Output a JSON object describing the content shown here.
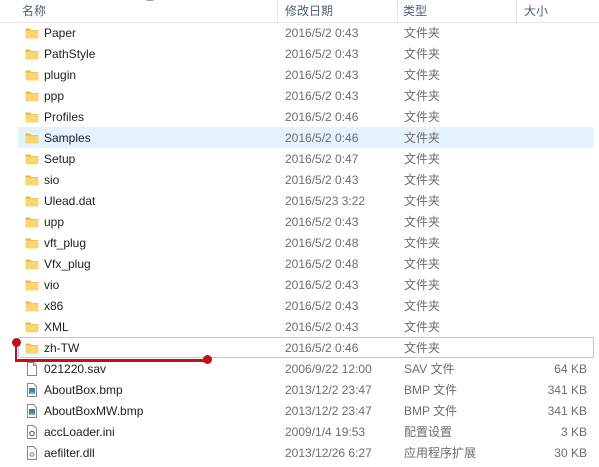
{
  "columns": {
    "name": "名称",
    "date": "修改日期",
    "type": "类型",
    "size": "大小"
  },
  "files": [
    {
      "name": "Paper",
      "date": "2016/5/2 0:43",
      "type": "文件夹",
      "size": "",
      "icon": "folder-icon",
      "state": ""
    },
    {
      "name": "PathStyle",
      "date": "2016/5/2 0:43",
      "type": "文件夹",
      "size": "",
      "icon": "folder-icon",
      "state": ""
    },
    {
      "name": "plugin",
      "date": "2016/5/2 0:43",
      "type": "文件夹",
      "size": "",
      "icon": "folder-icon",
      "state": ""
    },
    {
      "name": "ppp",
      "date": "2016/5/2 0:43",
      "type": "文件夹",
      "size": "",
      "icon": "folder-icon",
      "state": ""
    },
    {
      "name": "Profiles",
      "date": "2016/5/2 0:46",
      "type": "文件夹",
      "size": "",
      "icon": "folder-icon",
      "state": ""
    },
    {
      "name": "Samples",
      "date": "2016/5/2 0:46",
      "type": "文件夹",
      "size": "",
      "icon": "folder-icon",
      "state": "hover"
    },
    {
      "name": "Setup",
      "date": "2016/5/2 0:47",
      "type": "文件夹",
      "size": "",
      "icon": "folder-icon",
      "state": ""
    },
    {
      "name": "sio",
      "date": "2016/5/2 0:43",
      "type": "文件夹",
      "size": "",
      "icon": "folder-icon",
      "state": ""
    },
    {
      "name": "Ulead.dat",
      "date": "2016/5/23 3:22",
      "type": "文件夹",
      "size": "",
      "icon": "folder-icon",
      "state": ""
    },
    {
      "name": "upp",
      "date": "2016/5/2 0:43",
      "type": "文件夹",
      "size": "",
      "icon": "folder-icon",
      "state": ""
    },
    {
      "name": "vft_plug",
      "date": "2016/5/2 0:48",
      "type": "文件夹",
      "size": "",
      "icon": "folder-icon",
      "state": ""
    },
    {
      "name": "Vfx_plug",
      "date": "2016/5/2 0:48",
      "type": "文件夹",
      "size": "",
      "icon": "folder-icon",
      "state": ""
    },
    {
      "name": "vio",
      "date": "2016/5/2 0:43",
      "type": "文件夹",
      "size": "",
      "icon": "folder-icon",
      "state": ""
    },
    {
      "name": "x86",
      "date": "2016/5/2 0:43",
      "type": "文件夹",
      "size": "",
      "icon": "folder-icon",
      "state": ""
    },
    {
      "name": "XML",
      "date": "2016/5/2 0:43",
      "type": "文件夹",
      "size": "",
      "icon": "folder-icon",
      "state": ""
    },
    {
      "name": "zh-TW",
      "date": "2016/5/2 0:46",
      "type": "文件夹",
      "size": "",
      "icon": "folder-icon",
      "state": "focused"
    },
    {
      "name": "021220.sav",
      "date": "2006/9/22 12:00",
      "type": "SAV 文件",
      "size": "64 KB",
      "icon": "file-icon",
      "state": ""
    },
    {
      "name": "AboutBox.bmp",
      "date": "2013/12/2 23:47",
      "type": "BMP 文件",
      "size": "341 KB",
      "icon": "image-file-icon",
      "state": ""
    },
    {
      "name": "AboutBoxMW.bmp",
      "date": "2013/12/2 23:47",
      "type": "BMP 文件",
      "size": "341 KB",
      "icon": "image-file-icon",
      "state": ""
    },
    {
      "name": "accLoader.ini",
      "date": "2009/1/4 19:53",
      "type": "配置设置",
      "size": "3 KB",
      "icon": "settings-file-icon",
      "state": ""
    },
    {
      "name": "aefilter.dll",
      "date": "2013/12/26 6:27",
      "type": "应用程序扩展",
      "size": "30 KB",
      "icon": "dll-file-icon",
      "state": ""
    }
  ],
  "colors": {
    "folder": "#f7d674",
    "folder_dark": "#e2b845",
    "hover_bg": "#e5f3ff",
    "focus_border": "#99d1ff",
    "annotation": "#c0101a"
  }
}
